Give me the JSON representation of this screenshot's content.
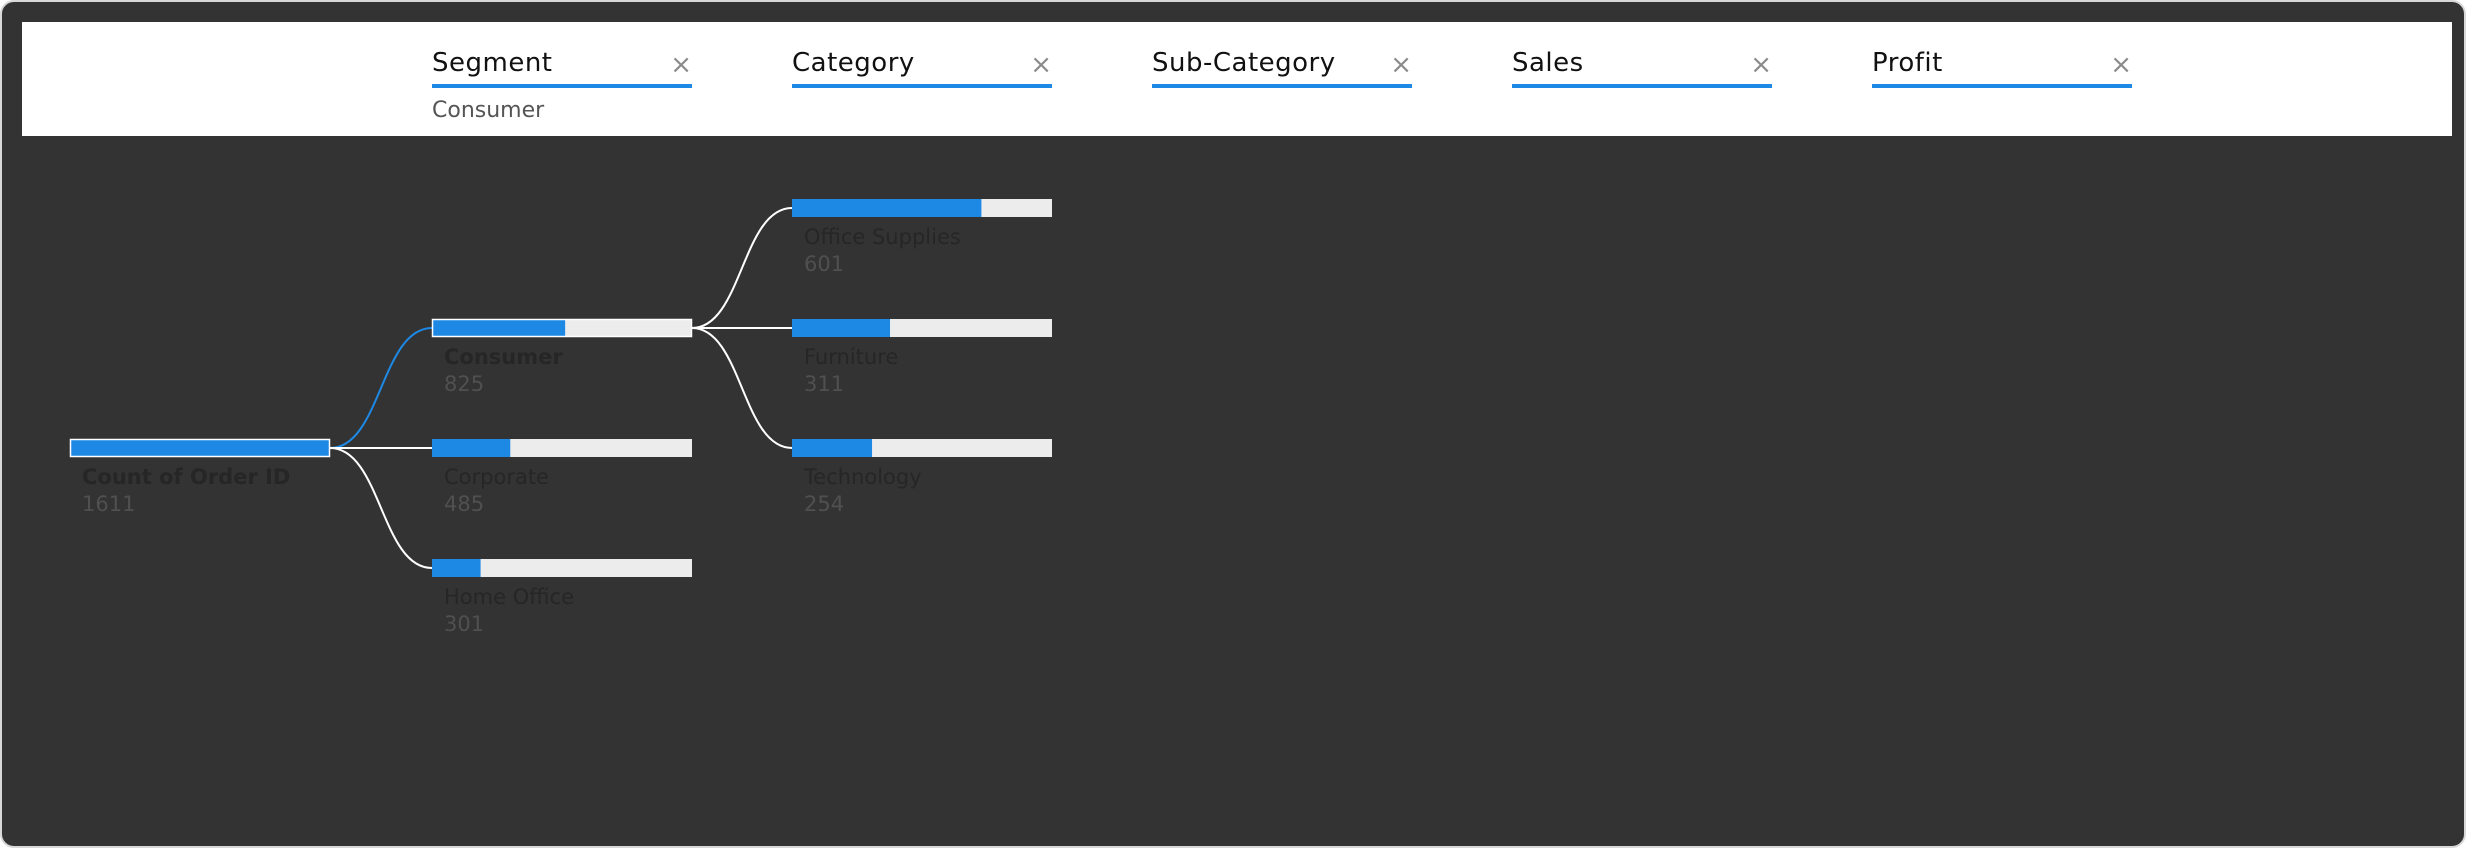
{
  "header": {
    "fields": [
      {
        "label": "Segment",
        "value": "Consumer"
      },
      {
        "label": "Category",
        "value": ""
      },
      {
        "label": "Sub-Category",
        "value": ""
      },
      {
        "label": "Sales",
        "value": ""
      },
      {
        "label": "Profit",
        "value": ""
      }
    ],
    "close_glyph": "×"
  },
  "colors": {
    "accent": "#1e88e5",
    "track": "#ececec",
    "connector": "#ffffff",
    "background": "#333333"
  },
  "chart_data": {
    "type": "decomposition_tree",
    "measure": "Count of Order ID",
    "root": {
      "label": "Count of Order ID",
      "value": 1611
    },
    "levels": [
      {
        "field": "Segment",
        "selected": "Consumer",
        "nodes": [
          {
            "label": "Consumer",
            "value": 825
          },
          {
            "label": "Corporate",
            "value": 485
          },
          {
            "label": "Home Office",
            "value": 301
          }
        ]
      },
      {
        "field": "Category",
        "selected": "",
        "nodes": [
          {
            "label": "Office Supplies",
            "value": 601
          },
          {
            "label": "Furniture",
            "value": 311
          },
          {
            "label": "Technology",
            "value": 254
          }
        ]
      }
    ]
  }
}
